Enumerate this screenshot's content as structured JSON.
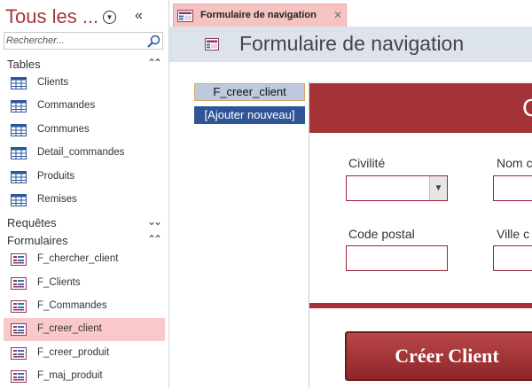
{
  "nav_pane": {
    "title": "Tous les ...",
    "search": {
      "placeholder": "Rechercher..."
    },
    "groups": {
      "tables": {
        "label": "Tables",
        "items": [
          "Clients",
          "Commandes",
          "Communes",
          "Detail_commandes",
          "Produits",
          "Remises"
        ]
      },
      "queries": {
        "label": "Requêtes"
      },
      "forms": {
        "label": "Formulaires",
        "items": [
          "F_chercher_client",
          "F_Clients",
          "F_Commandes",
          "F_creer_client",
          "F_creer_produit",
          "F_maj_produit"
        ],
        "selected": "F_creer_client"
      }
    }
  },
  "document_tab": {
    "label": "Formulaire de navigation",
    "close": "✕"
  },
  "form": {
    "title": "Formulaire de navigation",
    "navigation_buttons": [
      "F_creer_client",
      "[Ajouter nouveau]"
    ],
    "subform": {
      "header_title": "C",
      "fields": {
        "civilite": "Civilité",
        "nom": "Nom c",
        "code_postal": "Code postal",
        "ville": "Ville c"
      },
      "create_button": "Créer Client"
    }
  },
  "colors": {
    "accent": "#a4373a",
    "subform_header": "#a33336",
    "tab_active": "#f6c3c3",
    "nav_selected": "#f9c8c8",
    "nav_button_active": "#2f5597"
  }
}
